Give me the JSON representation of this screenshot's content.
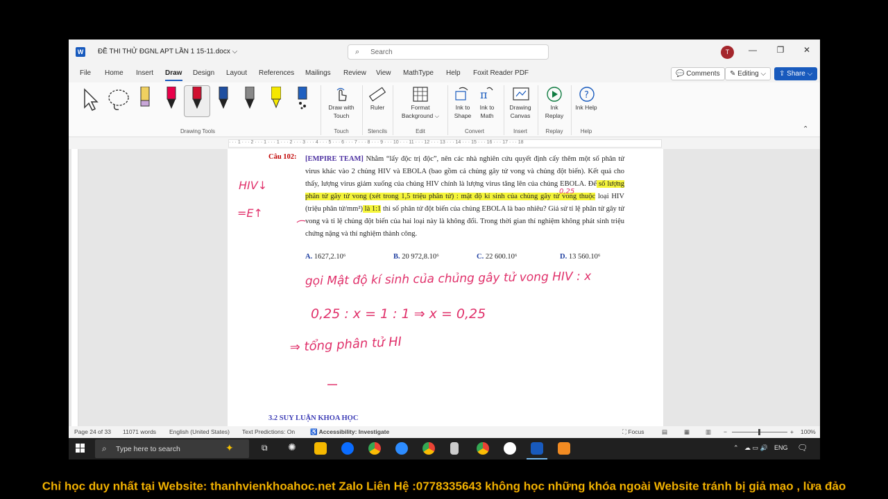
{
  "titlebar": {
    "doc_title": "ĐỀ THI THỬ ĐGNL APT LẦN 1 15-11.docx ⌵",
    "search_placeholder": "Search",
    "avatar_initial": "T",
    "logo_letter": "W"
  },
  "menu": {
    "tabs": [
      "File",
      "Home",
      "Insert",
      "Draw",
      "Design",
      "Layout",
      "References",
      "Mailings",
      "Review",
      "View",
      "MathType",
      "Help",
      "Foxit Reader PDF"
    ],
    "active_tab": "Draw",
    "comments_label": "Comments",
    "editing_label": "Editing ⌵",
    "share_label": "Share ⌵"
  },
  "ribbon": {
    "groups": {
      "drawing_tools": "Drawing Tools",
      "touch": "Touch",
      "stencils": "Stencils",
      "edit": "Edit",
      "convert": "Convert",
      "insert": "Insert",
      "replay": "Replay",
      "help": "Help"
    },
    "buttons": {
      "draw_with_touch": "Draw with Touch",
      "ruler": "Ruler",
      "format_background": "Format Background ⌵",
      "ink_to_shape": "Ink to Shape",
      "ink_to_math": "Ink to Math",
      "drawing_canvas": "Drawing Canvas",
      "ink_replay": "Ink Replay",
      "ink_help": "Ink Help"
    },
    "pen_colors": [
      "#000000",
      "#c8a6d8",
      "#e8004a",
      "#d01030",
      "#1f4fa0",
      "#888888",
      "#f5e800",
      "#2060c0"
    ]
  },
  "ruler": {
    "numbers": "· · · 1 · · · 2 · · · 1 · · · 1 · · · 2 · · · 3 · · · 4 · · · 5 · · · 6 · · · 7 · · · 8 · · · 9 · · · 10 · · · 11 · · · 12 · · · 13 · · · 14 · · · 15 · · · 16 · · · 17 · · · 18"
  },
  "document": {
    "question_label": "Câu 102:",
    "team": "[EMPIRE TEAM]",
    "text_1": " Nhằm “lấy độc trị độc”, nên các nhà nghiên cứu quyết định cấy thêm một số phân tử virus khác vào 2 chủng HIV và EBOLA (bao gồm cả chủng gây tử vong và chủng đột biến). Kết quả cho thấy, lượng virus giảm xuống của chủng HIV chính là lượng virus tăng lên của chủng EBOLA. Để",
    "highlight_1": " số lượng phân tử gây tử vong (xét trong 1,5 triệu phân tử) : mật độ kí sinh của chủng gây tử vong thuộc",
    "text_2": " loại HIV (triệu phân tử/mm²)",
    "highlight_2": " là 1:1",
    "text_3": " thì số phân tử đột biến của chủng EBOLA là bao nhiêu? Giả sử tỉ lệ phân tử gây tử vong và tỉ lệ chủng đột biến của hai loại này là không đổi. Trong thời gian thí nghiệm không phát sinh triệu chứng nặng và thí nghiệm thành công.",
    "options": [
      {
        "letter": "A.",
        "value": "1627,2.10⁶"
      },
      {
        "letter": "B.",
        "value": "20 972,8.10⁶"
      },
      {
        "letter": "C.",
        "value": "22 600.10⁶"
      },
      {
        "letter": "D.",
        "value": "13 560.10⁶"
      }
    ],
    "section_heading": "3.2 SUY LUẬN KHOA HỌC",
    "handwriting": {
      "left_1": "HIV↓",
      "left_2": "=E↑",
      "annot": "0,25",
      "line_1": "gọi Mật độ kí sinh của chủng gây tử vong HIV : x",
      "line_2": "0,25 : x = 1 : 1 ⇒ x = 0,25",
      "line_3": "⇒  tổng phân tử HI"
    }
  },
  "statusbar": {
    "page": "Page 24 of 33",
    "words": "11071 words",
    "language": "English (United States)",
    "predictions": "Text Predictions: On",
    "accessibility": "Accessibility: Investigate",
    "focus": "Focus",
    "zoom": "100%"
  },
  "taskbar": {
    "search_placeholder": "Type here to search",
    "lang": "ENG"
  },
  "footer": {
    "text": "Chỉ học duy nhất tại Website: thanhvienkhoahoc.net  Zalo Liên Hệ :0778335643 không học những khóa ngoài Website tránh bị giả mạo , lừa đảo"
  }
}
